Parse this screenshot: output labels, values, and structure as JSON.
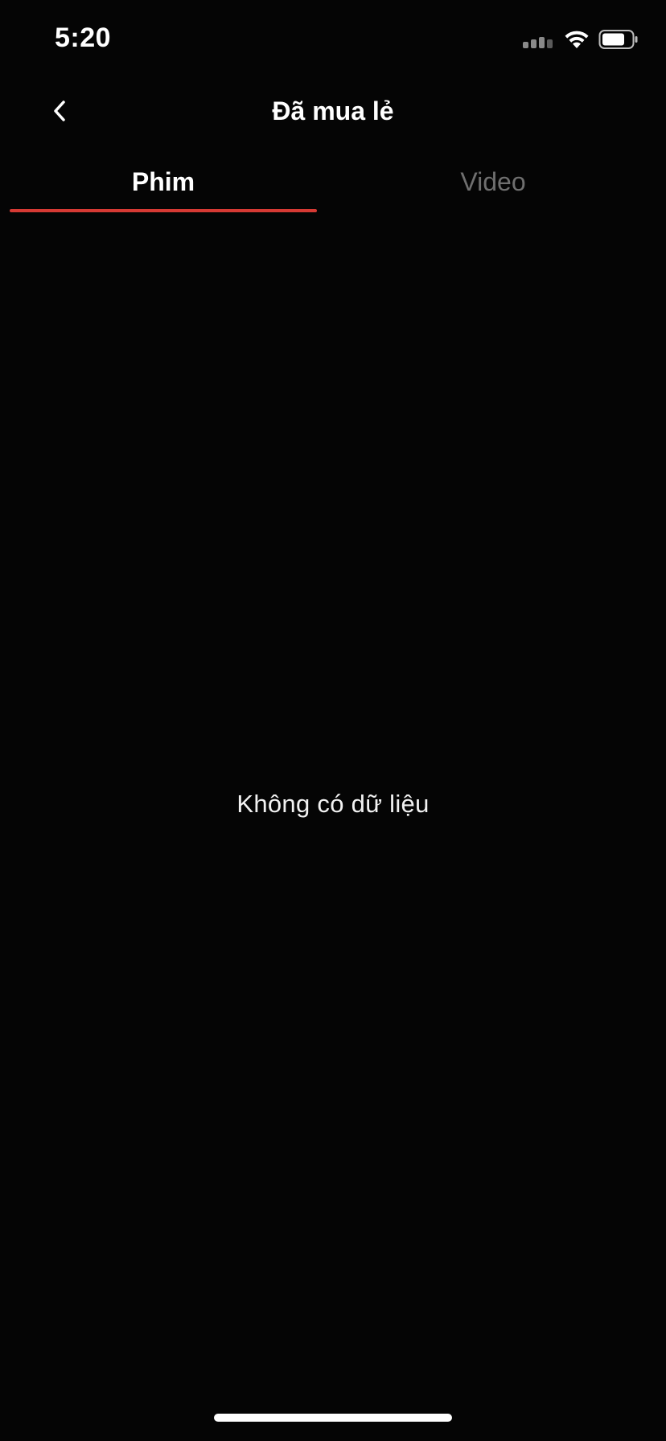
{
  "status_bar": {
    "time": "5:20",
    "icons": [
      "cellular-signal-icon",
      "wifi-icon",
      "battery-icon"
    ]
  },
  "header": {
    "back_icon": "chevron-left-icon",
    "title": "Đã mua lẻ"
  },
  "tabs": [
    {
      "label": "Phim",
      "active": true
    },
    {
      "label": "Video",
      "active": false
    }
  ],
  "empty_state": {
    "message": "Không có dữ liệu"
  },
  "colors": {
    "background": "#050505",
    "accent": "#d63a34",
    "active_tab_text": "#ffffff",
    "inactive_tab_text": "#6f6f6f"
  }
}
